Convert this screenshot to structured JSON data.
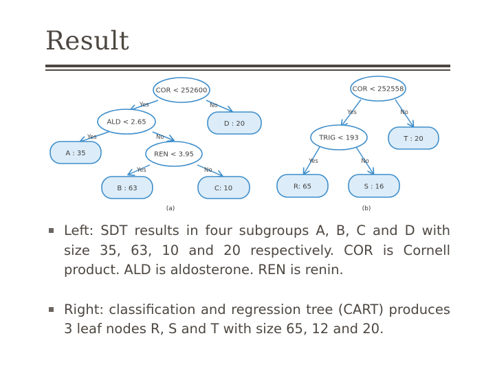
{
  "slide": {
    "title": "Result"
  },
  "figure": {
    "colors": {
      "stroke": "#3e8ecb",
      "leaf_fill": "#dcecf8",
      "decision_fill": "#ffffff"
    },
    "tree_a": {
      "caption": "(a)",
      "nodes": {
        "root": "COR < 252600",
        "ald": "ALD < 2.65",
        "ren": "REN < 3.95",
        "leaf_a": "A : 35",
        "leaf_b": "B : 63",
        "leaf_c": "C: 10",
        "leaf_d": "D : 20"
      },
      "edges": {
        "root_yes": "Yes",
        "root_no": "No",
        "ald_yes": "Yes",
        "ald_no": "No",
        "ren_yes": "Yes",
        "ren_no": "No"
      }
    },
    "tree_b": {
      "caption": "(b)",
      "nodes": {
        "root": "COR < 252558",
        "trig": "TRIG < 193",
        "leaf_r": "R: 65",
        "leaf_s": "S : 16",
        "leaf_t": "T : 20"
      },
      "edges": {
        "root_yes": "Yes",
        "root_no": "No",
        "trig_yes": "Yes",
        "trig_no": "No"
      }
    }
  },
  "bullets": [
    "Left: SDT results in four subgroups A, B, C and D with size 35, 63, 10 and 20 respectively. COR is Cornell product. ALD is aldosterone. REN is renin.",
    "Right: classification and regression tree (CART) produces 3 leaf nodes R, S and T with size 65, 12 and 20."
  ]
}
